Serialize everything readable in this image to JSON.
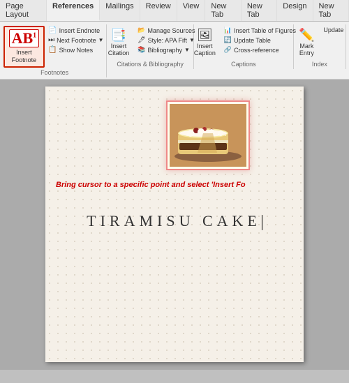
{
  "tabs": [
    {
      "label": "Page Layout",
      "active": false
    },
    {
      "label": "References",
      "active": true
    },
    {
      "label": "Mailings",
      "active": false
    },
    {
      "label": "Review",
      "active": false
    },
    {
      "label": "View",
      "active": false
    },
    {
      "label": "New Tab",
      "active": false
    },
    {
      "label": "New Tab",
      "active": false
    },
    {
      "label": "Design",
      "active": false
    },
    {
      "label": "New Tab",
      "active": false
    }
  ],
  "groups": {
    "footnotes": {
      "label": "Footnotes",
      "insert_footnote": "Insert\nFootnote",
      "insert_endnote": "Insert Endnote",
      "next_footnote": "Next Footnote",
      "show_notes": "Show Notes"
    },
    "citations": {
      "label": "Citations & Bibliography",
      "manage_sources": "Manage Sources",
      "style": "Style: APA Fift",
      "insert_citation": "Insert\nCitation",
      "bibliography": "Bibliography"
    },
    "captions": {
      "label": "Captions",
      "caption_label": "Caption",
      "insert_caption": "Insert\nCaption",
      "insert_table_of_figures": "Insert Table of Figures",
      "update_table": "Update Table",
      "cross_reference": "Cross-reference"
    },
    "index": {
      "label": "Index",
      "mark_entry": "Mark\nEntry",
      "update_index": "Update"
    }
  },
  "document": {
    "instruction": "Bring cursor to a specific point and select 'Insert Fo",
    "title": "TIRAMISU CAKE"
  }
}
